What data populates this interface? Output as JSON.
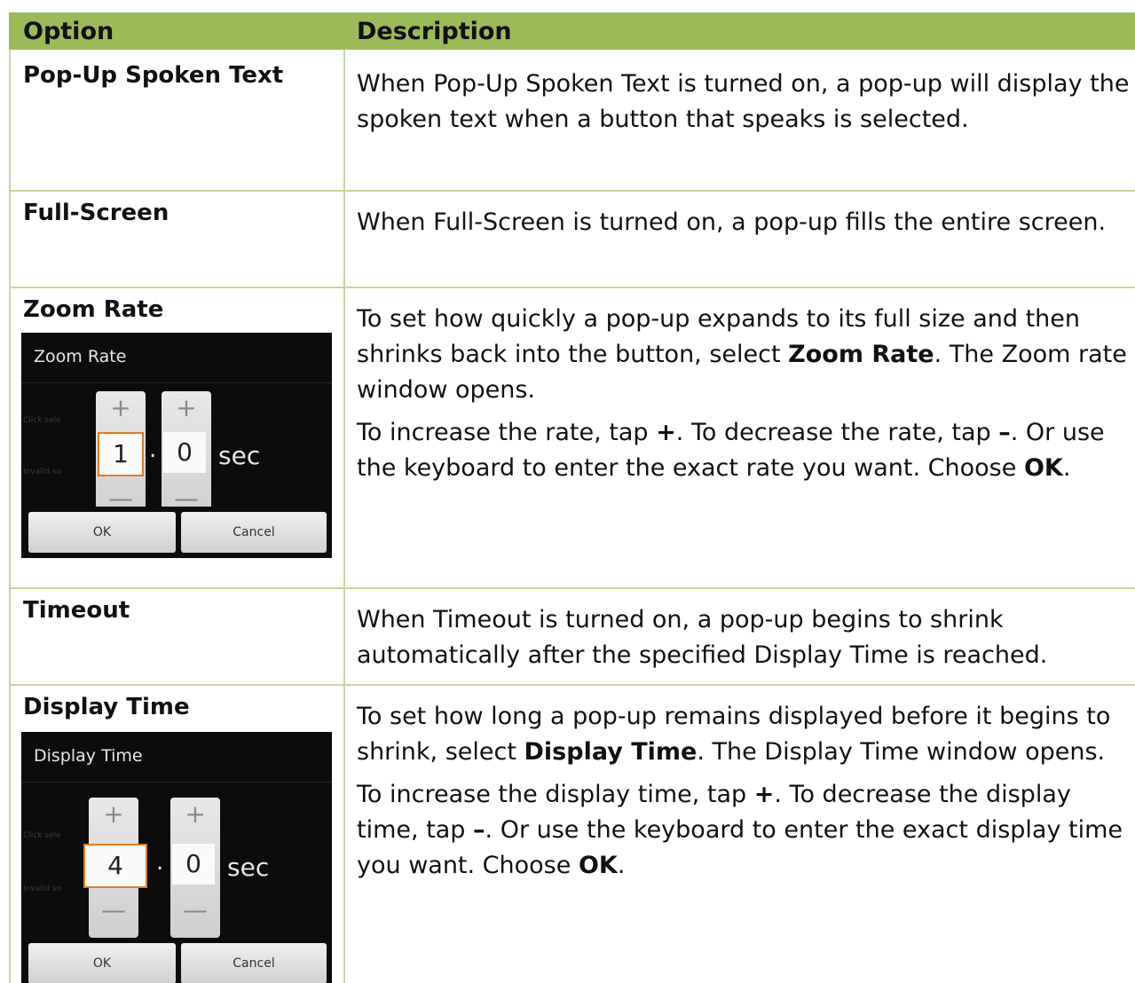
{
  "header": {
    "option": "Option",
    "description": "Description"
  },
  "rows": [
    {
      "option": "Pop-Up Spoken Text",
      "desc": "When Pop-Up Spoken Text is turned on, a pop-up will display the spoken text when a button that speaks is selected."
    },
    {
      "option": "Full-Screen",
      "desc": "When Full-Screen is turned on, a pop-up fills the entire screen."
    },
    {
      "option": "Zoom Rate",
      "desc_p1_a": "To set how quickly a pop-up expands to its full size and then shrinks back into the button, select ",
      "desc_p1_b": "Zoom Rate",
      "desc_p1_c": ". The Zoom rate window opens.",
      "desc_p2_a": "To increase the rate, tap ",
      "desc_p2_b": "+",
      "desc_p2_c": ". To decrease the rate, tap ",
      "desc_p2_d": "–",
      "desc_p2_e": ". Or use the keyboard to enter the exact rate you want. Choose ",
      "desc_p2_f": "OK",
      "desc_p2_g": ".",
      "dialog": {
        "title": "Zoom Rate",
        "ghost1": "Click sele",
        "ghost2": "Invalid so",
        "plus": "+",
        "minus": "—",
        "whole": "1",
        "dot": ".",
        "fraction": "0",
        "unit": "sec",
        "ok": "OK",
        "cancel": "Cancel"
      }
    },
    {
      "option": "Timeout",
      "desc": "When Timeout is turned on, a pop-up begins to shrink automatically after the specified Display Time is reached."
    },
    {
      "option": "Display Time",
      "desc_p1_a": "To set how long a pop-up remains displayed before it begins to shrink, select ",
      "desc_p1_b": "Display Time",
      "desc_p1_c": ". The Display Time window opens.",
      "desc_p2_a": "To increase the display time, tap ",
      "desc_p2_b": "+",
      "desc_p2_c": ". To decrease the display time, tap ",
      "desc_p2_d": "–",
      "desc_p2_e": ". Or use the keyboard to enter the exact display time you want. Choose ",
      "desc_p2_f": "OK",
      "desc_p2_g": ".",
      "dialog": {
        "title": "Display Time",
        "ghost1": "Click sele",
        "ghost2": "Invalid so",
        "plus": "+",
        "minus": "—",
        "whole": "4",
        "dot": ".",
        "fraction": "0",
        "unit": "sec",
        "ok": "OK",
        "cancel": "Cancel"
      }
    }
  ]
}
